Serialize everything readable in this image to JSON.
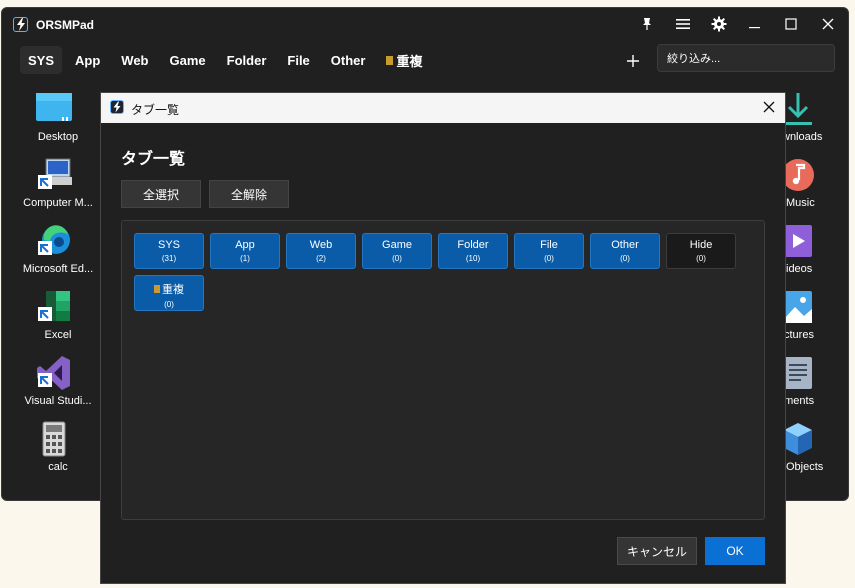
{
  "app": {
    "title": "ORSMPad"
  },
  "tabs": [
    {
      "label": "SYS",
      "active": true
    },
    {
      "label": "App"
    },
    {
      "label": "Web"
    },
    {
      "label": "Game"
    },
    {
      "label": "Folder"
    },
    {
      "label": "File"
    },
    {
      "label": "Other"
    },
    {
      "label": "重複",
      "icon": "duplicate-icon"
    }
  ],
  "filter": {
    "placeholder": "絞り込み..."
  },
  "left_tiles": [
    {
      "label": "Desktop",
      "icon": "desktop-icon"
    },
    {
      "label": "Computer M...",
      "icon": "computer-management-icon"
    },
    {
      "label": "Microsoft Ed...",
      "icon": "edge-icon"
    },
    {
      "label": "Excel",
      "icon": "excel-icon"
    },
    {
      "label": "Visual Studi...",
      "icon": "visual-studio-icon"
    },
    {
      "label": "calc",
      "icon": "calculator-icon"
    }
  ],
  "right_tiles": [
    {
      "label": "wnloads",
      "icon": "downloads-icon"
    },
    {
      "label": "Music",
      "icon": "music-icon"
    },
    {
      "label": "ideos",
      "icon": "videos-icon"
    },
    {
      "label": "ctures",
      "icon": "pictures-icon"
    },
    {
      "label": "uments",
      "icon": "documents-icon"
    },
    {
      "label": "Objects",
      "icon": "3d-objects-icon"
    }
  ],
  "dialog": {
    "title": "タブ一覧",
    "heading": "タブ一覧",
    "select_all": "全選択",
    "deselect_all": "全解除",
    "chips": [
      {
        "name": "SYS",
        "count": "(31)",
        "selected": true
      },
      {
        "name": "App",
        "count": "(1)",
        "selected": true
      },
      {
        "name": "Web",
        "count": "(2)",
        "selected": true
      },
      {
        "name": "Game",
        "count": "(0)",
        "selected": true
      },
      {
        "name": "Folder",
        "count": "(10)",
        "selected": true
      },
      {
        "name": "File",
        "count": "(0)",
        "selected": true
      },
      {
        "name": "Other",
        "count": "(0)",
        "selected": true
      },
      {
        "name": "Hide",
        "count": "(0)",
        "selected": false
      },
      {
        "name": "重複",
        "count": "(0)",
        "selected": true,
        "icon": "duplicate-icon"
      }
    ],
    "cancel": "キャンセル",
    "ok": "OK"
  },
  "colors": {
    "accent": "#0b70d3",
    "chip_selected": "#0a5ca8",
    "background": "#202020"
  }
}
